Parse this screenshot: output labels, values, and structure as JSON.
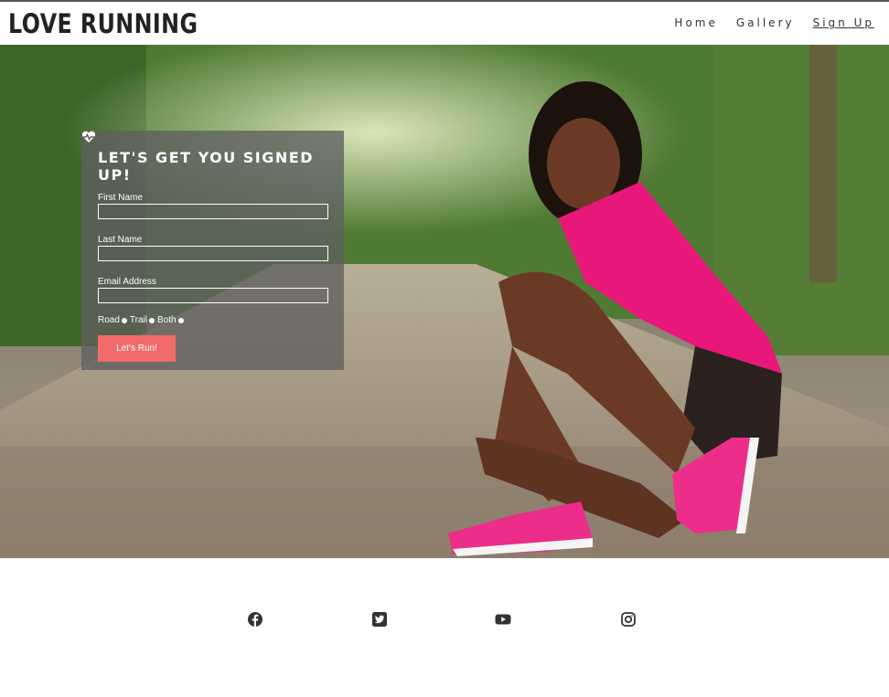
{
  "brand": {
    "title": "LOVE RUNNING"
  },
  "nav": {
    "items": [
      "Home",
      "Gallery",
      "Sign Up"
    ],
    "active": "Sign Up"
  },
  "form": {
    "title": "LET'S GET YOU SIGNED UP!",
    "first_name_label": "First Name",
    "last_name_label": "Last Name",
    "email_label": "Email Address",
    "radio_options": [
      "Road",
      "Trail",
      "Both"
    ],
    "submit_label": "Let's Run!"
  },
  "footer": {
    "icons": [
      "facebook-icon",
      "twitter-icon",
      "youtube-icon",
      "instagram-icon"
    ]
  },
  "colors": {
    "accent": "#f26b6b",
    "shirt": "#e8177a",
    "card": "#5f5f5f"
  }
}
